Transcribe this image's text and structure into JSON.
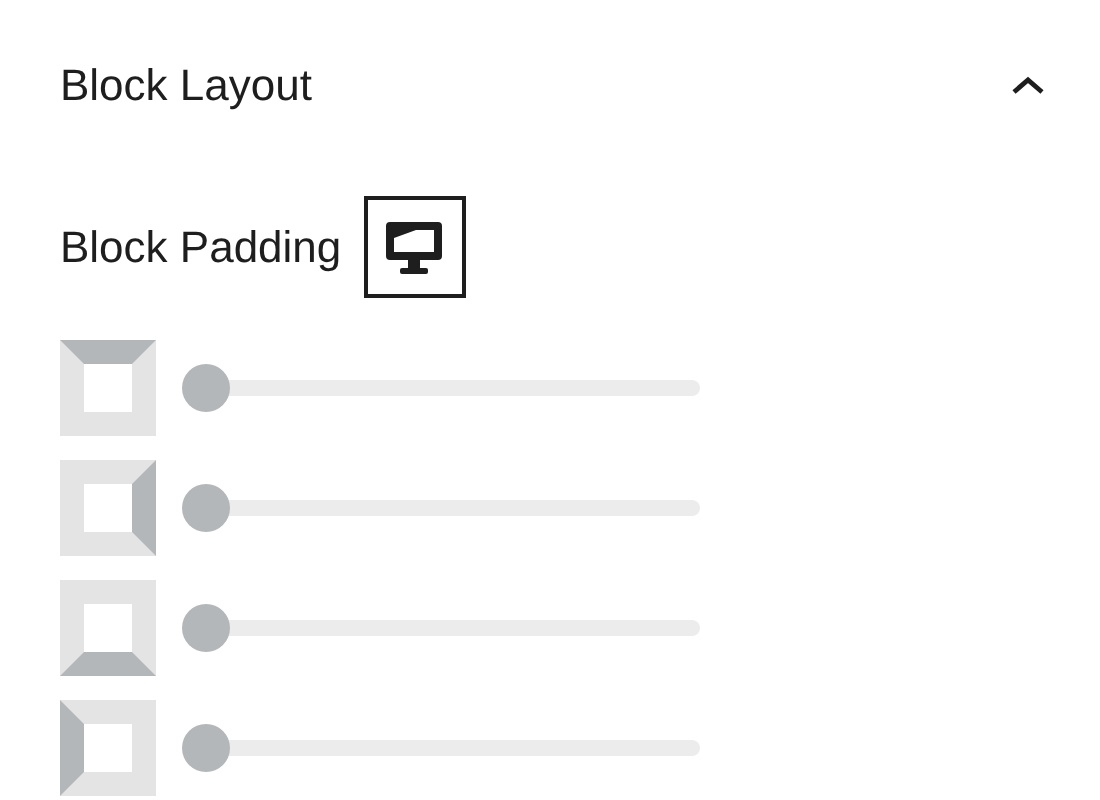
{
  "panel": {
    "title": "Block Layout",
    "expanded": true
  },
  "padding": {
    "label": "Block Padding",
    "sides": [
      {
        "kind": "top",
        "level": 0
      },
      {
        "kind": "right",
        "level": 0
      },
      {
        "kind": "bottom",
        "level": 0
      },
      {
        "kind": "left",
        "level": 0
      }
    ]
  }
}
